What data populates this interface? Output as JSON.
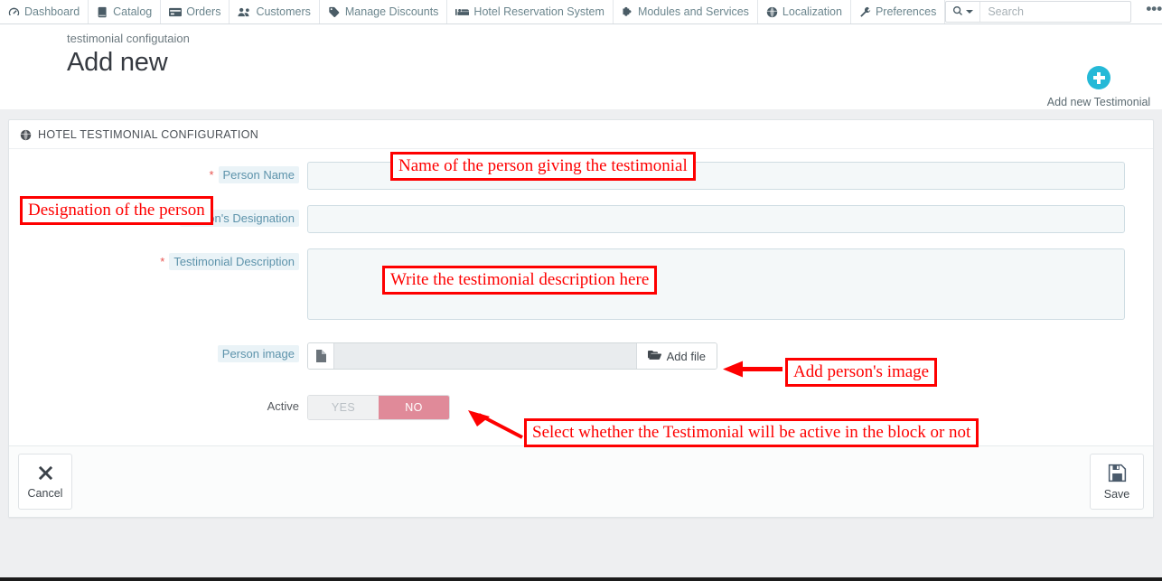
{
  "topnav": {
    "items": [
      {
        "label": "Dashboard",
        "icon": "gauge-icon"
      },
      {
        "label": "Catalog",
        "icon": "book-icon"
      },
      {
        "label": "Orders",
        "icon": "card-icon"
      },
      {
        "label": "Customers",
        "icon": "people-icon"
      },
      {
        "label": "Manage Discounts",
        "icon": "tag-icon"
      },
      {
        "label": "Hotel Reservation System",
        "icon": "bed-icon"
      },
      {
        "label": "Modules and Services",
        "icon": "puzzle-icon"
      },
      {
        "label": "Localization",
        "icon": "globe-icon"
      },
      {
        "label": "Preferences",
        "icon": "wrench-icon"
      }
    ],
    "search": {
      "placeholder": "Search",
      "value": "",
      "toggle_icon": "search-icon"
    },
    "overflow_label": "•••"
  },
  "header": {
    "breadcrumb": "testimonial configutaion",
    "title": "Add new",
    "action": {
      "label": "Add new Testimonial",
      "icon": "plus-circle-icon",
      "color": "#25b9d7"
    }
  },
  "panel": {
    "heading": "HOTEL TESTIMONIAL CONFIGURATION",
    "heading_icon": "globe-icon",
    "fields": {
      "person_name": {
        "label": "Person Name",
        "required": true,
        "value": "",
        "placeholder": ""
      },
      "person_designation": {
        "label": "Person's Designation",
        "required": true,
        "value": "",
        "placeholder": ""
      },
      "testimonial_description": {
        "label": "Testimonial Description",
        "required": true,
        "value": "",
        "placeholder": ""
      },
      "person_image": {
        "label": "Person image",
        "required": false,
        "value": "",
        "button_label": "Add file",
        "button_icon": "folder-open-icon",
        "field_icon": "file-icon"
      },
      "active": {
        "label": "Active",
        "options": [
          "YES",
          "NO"
        ],
        "selected": "NO",
        "on_color": "#e08a99"
      }
    },
    "footer": {
      "cancel_label": "Cancel",
      "cancel_icon": "close-x-icon",
      "save_label": "Save",
      "save_icon": "floppy-disk-icon"
    }
  },
  "annotations": {
    "name": "Name of the person giving the testimonial",
    "designation": "Designation of the person",
    "description": "Write the testimonial description here",
    "image": "Add person's image",
    "active": "Select whether the Testimonial will be active in the block or not",
    "color": "#fe0000"
  }
}
